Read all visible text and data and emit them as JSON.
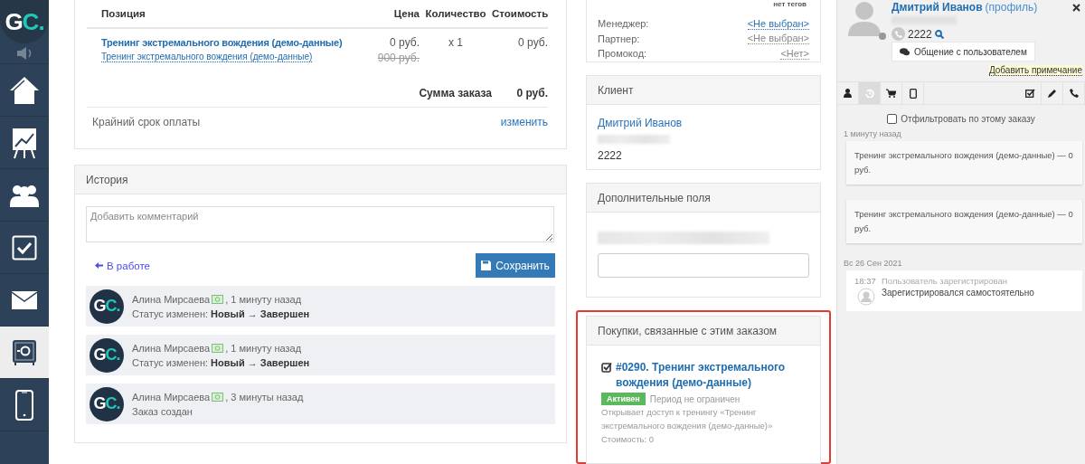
{
  "sidebar": {
    "logo": "GC.",
    "items": [
      {
        "kind": "sound",
        "selected": false
      },
      {
        "kind": "home",
        "selected": false
      },
      {
        "kind": "chart",
        "selected": false
      },
      {
        "kind": "users",
        "selected": false
      },
      {
        "kind": "tasks",
        "selected": false
      },
      {
        "kind": "mail",
        "selected": false
      },
      {
        "kind": "safe",
        "selected": true
      },
      {
        "kind": "phone",
        "selected": false
      }
    ]
  },
  "order": {
    "columns": [
      "Позиция",
      "Цена",
      "Количество",
      "Стоимость"
    ],
    "items": [
      {
        "title": "Тренинг экстремального вождения (демо-данные)",
        "subtitle": "Тренинг экстремального вождения (демо-данные)",
        "price": "0 руб.",
        "old_price": "900 руб.",
        "quantity": "x 1",
        "cost": "0 руб."
      }
    ],
    "total_label": "Сумма заказа",
    "total": "0 руб.",
    "deadline_label": "Крайний срок оплаты",
    "deadline_action": "изменить"
  },
  "history": {
    "title": "История",
    "comment_placeholder": "Добавить комментарий",
    "status_link": "В работе",
    "save_button": "Сохранить",
    "entries": [
      {
        "avatar": "GC.",
        "author": "Алина Мирсаева",
        "time": ", 1 минуту назад",
        "text": "Статус изменен: **Новый → Завершен**"
      },
      {
        "avatar": "GC.",
        "author": "Алина Мирсаева",
        "time": ", 1 минуту назад",
        "text": "Статус изменен: **Новый → Завершен**"
      },
      {
        "avatar": "GC.",
        "author": "Алина Мирсаева",
        "time": ", 3 минуты назад",
        "text": "Заказ создан"
      }
    ]
  },
  "order_meta": {
    "tags_value": "нет тегов",
    "fields": [
      {
        "label": "Менеджер:",
        "value": "<Не выбран>",
        "kind": "link"
      },
      {
        "label": "Партнер:",
        "value": "<Не выбран>",
        "kind": "muted"
      },
      {
        "label": "Промокод:",
        "value": "<Нет>",
        "kind": "muted"
      }
    ]
  },
  "client": {
    "title": "Клиент",
    "name": "Дмитрий Иванов",
    "phone": "2222"
  },
  "extra_fields": {
    "title": "Дополнительные поля"
  },
  "purchases": {
    "title": "Покупки, связанные с этим заказом",
    "highlighted": true,
    "items": [
      {
        "title": "#0290. Тренинг экстремального вождения (демо-данные)",
        "status": "Активен",
        "period": "Период не ограничен",
        "description": "Открывает доступ к тренингу «Тренинг экстремального вождения (демо-данные)»",
        "cost": "Стоимость: 0"
      }
    ]
  },
  "user_panel": {
    "name": "Дмитрий Иванов",
    "profile_link": "(профиль)",
    "phone": "2222",
    "chat_button": "Общение с пользователем",
    "note_link": "Добавить примечание",
    "tabs": [
      {
        "kind": "user",
        "selected": false
      },
      {
        "kind": "history",
        "selected": true
      },
      {
        "kind": "cart",
        "selected": false
      },
      {
        "kind": "tablet",
        "selected": false
      },
      {
        "kind": "task",
        "selected": false
      },
      {
        "kind": "pencil",
        "selected": false
      },
      {
        "kind": "phone",
        "selected": false
      }
    ],
    "filter": {
      "label": "Отфильтровать по этому заказу",
      "checked": false
    },
    "groups": [
      {
        "date": "1 минуту назад",
        "events": [
          {
            "kind": "card",
            "text": "Тренинг экстремального вождения (демо-данные) — 0 руб."
          },
          {
            "kind": "card",
            "text": "Тренинг экстремального вождения (демо-данные) — 0 руб."
          }
        ]
      },
      {
        "date": "Вс 26 Сен 2021",
        "events": [
          {
            "kind": "log",
            "time": "18:37",
            "title": "Пользователь зарегистрирован",
            "text": "Зарегистрировался самостоятельно"
          }
        ]
      }
    ]
  }
}
